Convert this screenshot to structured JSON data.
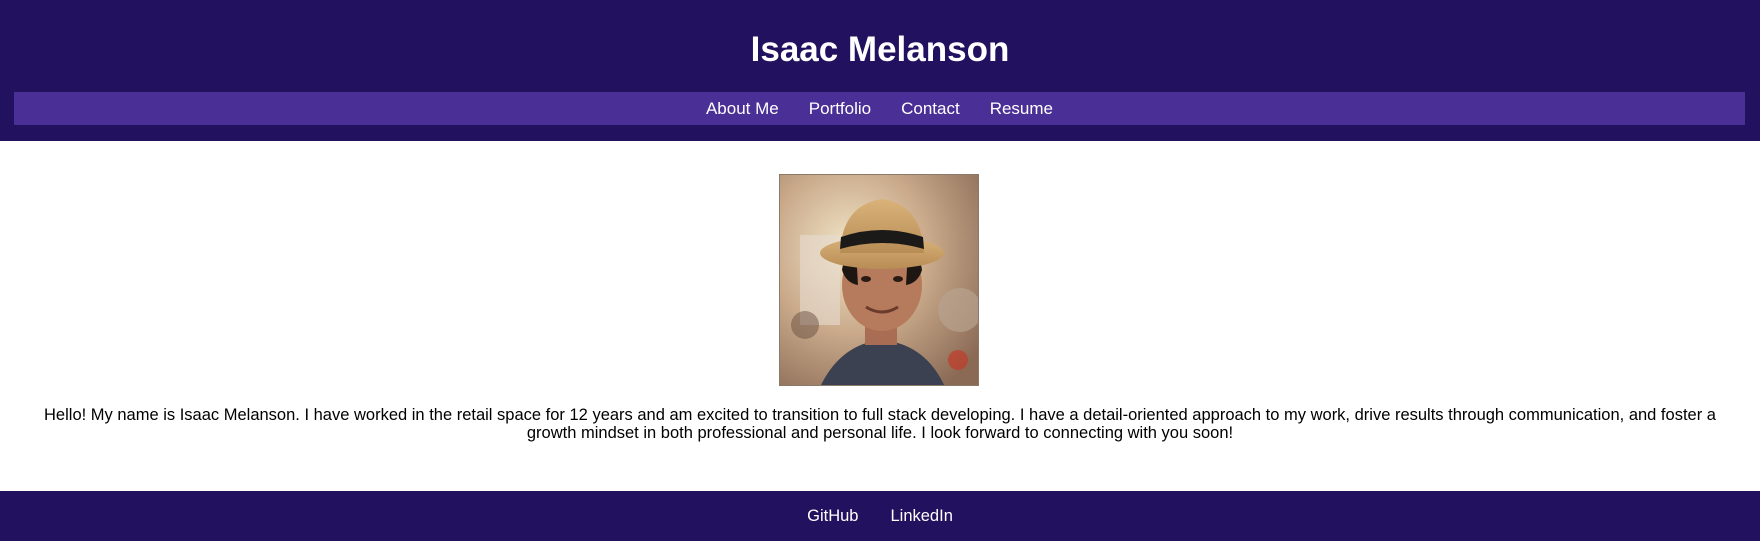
{
  "header": {
    "title": "Isaac Melanson",
    "nav": [
      {
        "label": "About Me"
      },
      {
        "label": "Portfolio"
      },
      {
        "label": "Contact"
      },
      {
        "label": "Resume"
      }
    ]
  },
  "main": {
    "bio": "Hello! My name is Isaac Melanson. I have worked in the retail space for 12 years and am excited to transition to full stack developing. I have a detail-oriented approach to my work, drive results through communication, and foster a growth mindset in both professional and personal life. I look forward to connecting with you soon!"
  },
  "footer": {
    "links": [
      {
        "label": "GitHub"
      },
      {
        "label": "LinkedIn"
      }
    ]
  },
  "colors": {
    "header_bg": "#22115e",
    "nav_bg": "#4a2f96",
    "text_light": "#ffffff"
  }
}
